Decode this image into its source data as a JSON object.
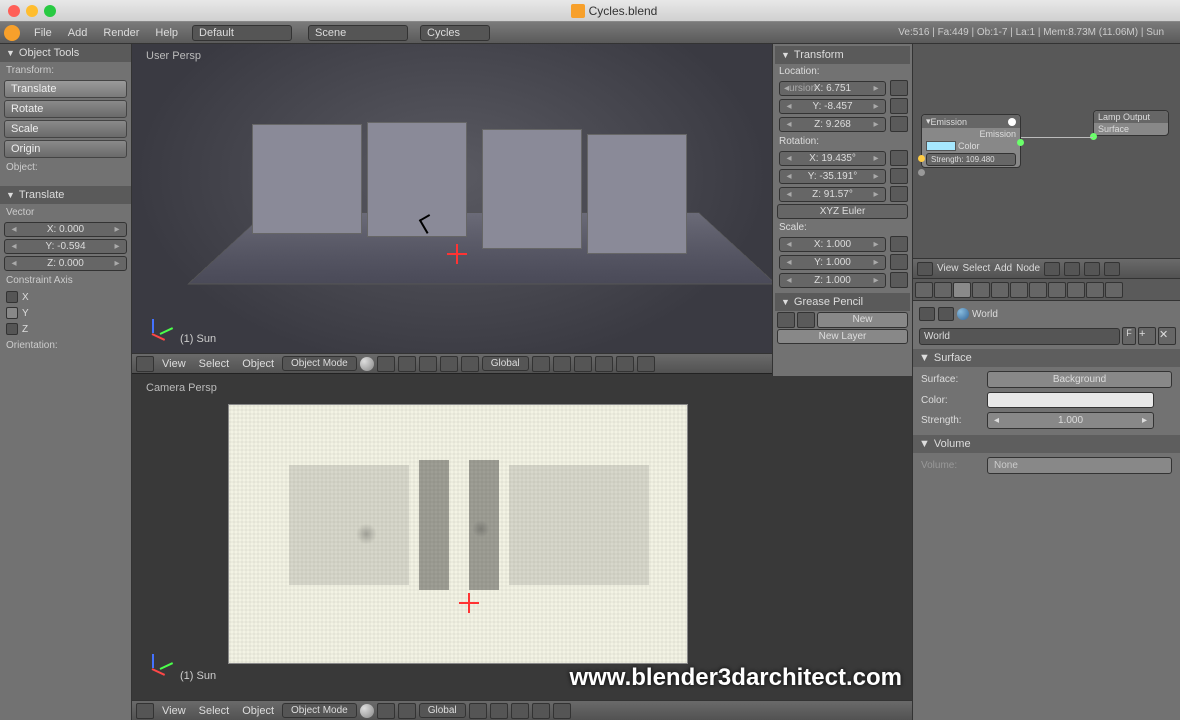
{
  "titlebar": {
    "filename": "Cycles.blend"
  },
  "topmenu": {
    "items": [
      "File",
      "Add",
      "Render",
      "Help"
    ],
    "layout": "Default",
    "scene": "Scene",
    "engine": "Cycles",
    "stats": "Ve:516 | Fa:449 | Ob:1-7 | La:1 | Mem:8.73M (11.06M) | Sun"
  },
  "toolshelf": {
    "header": "Object Tools",
    "transform_label": "Transform:",
    "translate": "Translate",
    "rotate": "Rotate",
    "scale": "Scale",
    "origin": "Origin",
    "object_label": "Object:",
    "operator_header": "Translate",
    "vector_label": "Vector",
    "vec_x": "X: 0.000",
    "vec_y": "Y: -0.594",
    "vec_z": "Z: 0.000",
    "constraint_label": "Constraint Axis",
    "axis_x": "X",
    "axis_y": "Y",
    "axis_z": "Z",
    "orientation_label": "Orientation:"
  },
  "viewport": {
    "top_label": "User Persp",
    "bottom_label": "Camera Persp",
    "object_name": "(1) Sun",
    "header": {
      "view": "View",
      "select": "Select",
      "object": "Object",
      "mode": "Object Mode",
      "orient": "Global"
    },
    "overlay_url": "www.blender3darchitect.com"
  },
  "npanel": {
    "header": "Transform",
    "location_label": "Location:",
    "loc_x": "X: 6.751",
    "loc_y": "Y: -8.457",
    "loc_z": "Z: 9.268",
    "rotation_label": "Rotation:",
    "rot_x": "X: 19.435°",
    "rot_y": "Y: -35.191°",
    "rot_z": "Z: 91.57°",
    "rot_mode": "XYZ Euler",
    "scale_label": "Scale:",
    "scl_x": "X: 1.000",
    "scl_y": "Y: 1.000",
    "scl_z": "Z: 1.000",
    "gp_header": "Grease Pencil",
    "gp_new": "New",
    "gp_layer": "New Layer"
  },
  "node_editor": {
    "emission_title": "Emission",
    "emission_out": "Emission",
    "color_label": "Color",
    "strength": "Strength: 109.480",
    "lamp_output": "Lamp Output",
    "surface": "Surface",
    "menu": {
      "view": "View",
      "select": "Select",
      "add": "Add",
      "node": "Node"
    }
  },
  "properties": {
    "breadcrumb": "World",
    "datablock": "World",
    "f_btn": "F",
    "surface_header": "Surface",
    "surface_label": "Surface:",
    "surface_val": "Background",
    "color_label": "Color:",
    "strength_label": "Strength:",
    "strength_val": "1.000",
    "volume_header": "Volume",
    "volume_label": "Volume:",
    "volume_val": "None"
  }
}
